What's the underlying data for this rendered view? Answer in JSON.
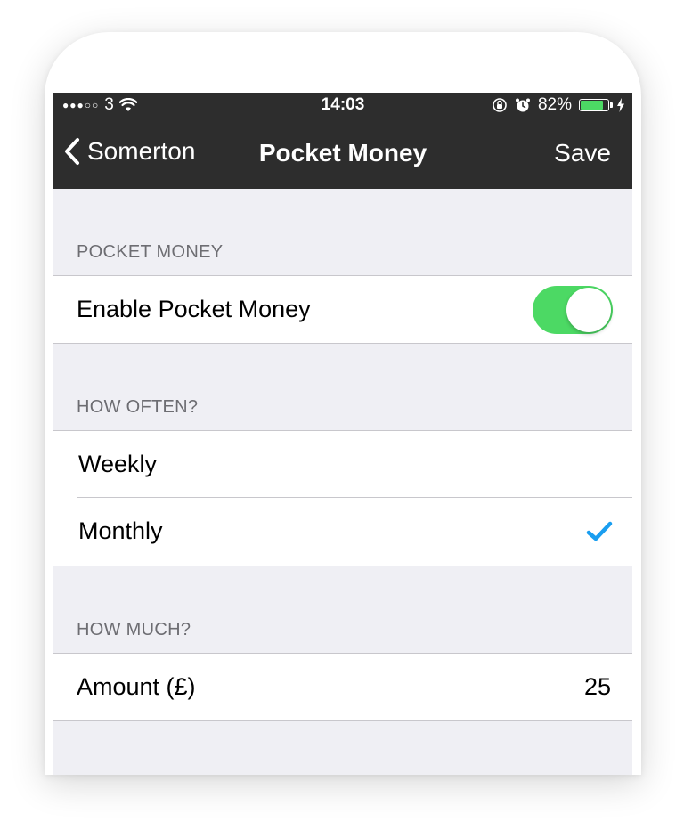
{
  "status_bar": {
    "carrier": "3",
    "time": "14:03",
    "battery_percent": "82%",
    "battery_level": 0.82,
    "battery_color": "#4cd964"
  },
  "nav": {
    "back_label": "Somerton",
    "title": "Pocket Money",
    "save_label": "Save"
  },
  "sections": {
    "pocket_money": {
      "header": "POCKET MONEY",
      "enable_label": "Enable Pocket Money",
      "enabled": true
    },
    "how_often": {
      "header": "HOW OFTEN?",
      "options": [
        "Weekly",
        "Monthly"
      ],
      "selected": "Monthly"
    },
    "how_much": {
      "header": "HOW MUCH?",
      "amount_label": "Amount (£)",
      "amount_value": "25"
    }
  },
  "colors": {
    "accent_check": "#1a9ef0",
    "toggle_on": "#4cd964",
    "bar_background": "#2d2d2d"
  }
}
